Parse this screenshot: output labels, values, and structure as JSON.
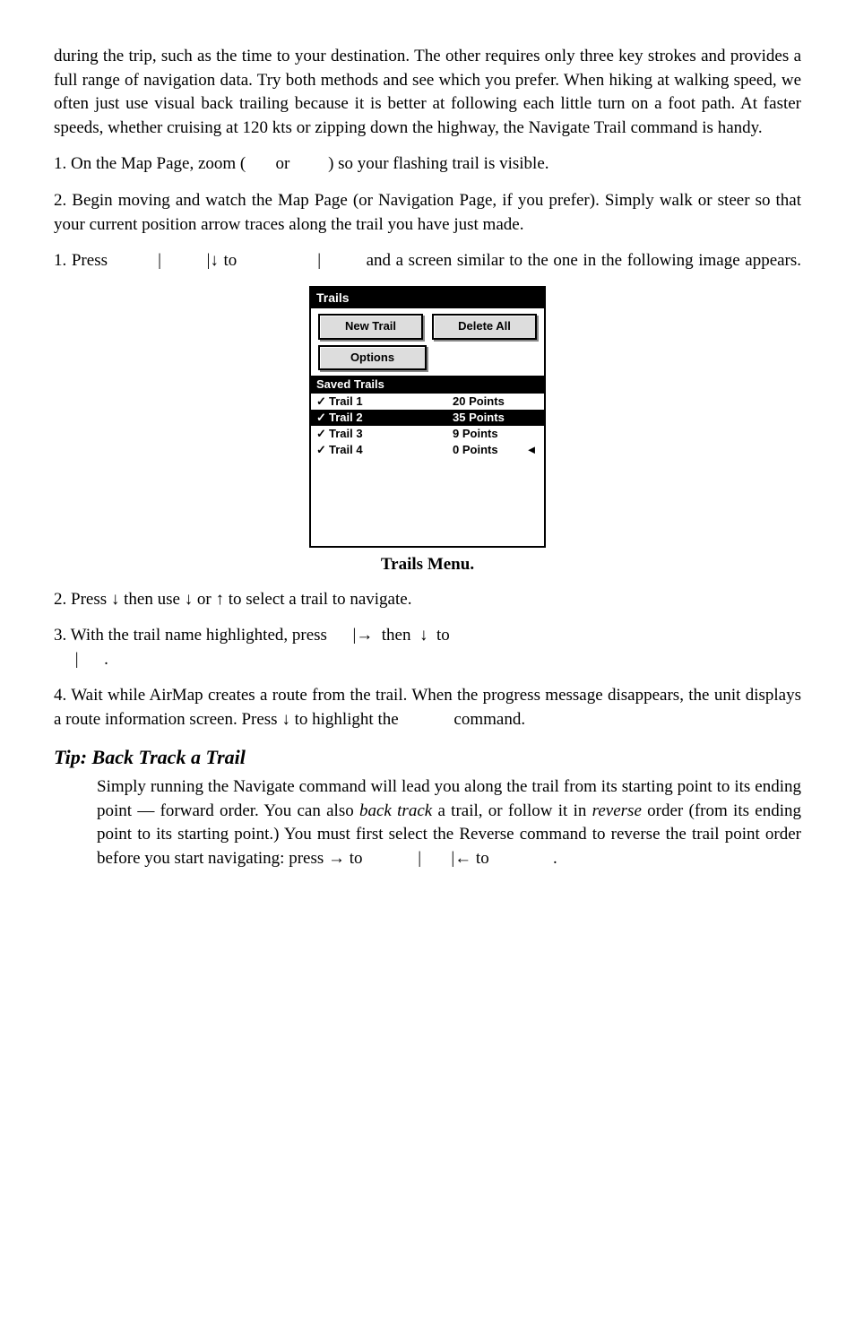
{
  "para_intro": "during the trip, such as the time to your destination. The other requires only three key strokes and provides a full range of navigation data. Try both methods and see which you prefer. When hiking at walking speed, we often just use visual back trailing because it is better at following each little turn on a foot path. At faster speeds, whether cruising at 120 kts or zipping down the highway, the Navigate Trail command is handy.",
  "step1a_pre": "1. On the Map Page, zoom (",
  "step1a_mid": "or",
  "step1a_post": ") so your flashing trail is visible.",
  "step2a": "2. Begin moving and watch the Map Page (or Navigation Page, if you prefer). Simply walk or steer so that your current position arrow traces along the trail you have just made.",
  "step1b_pre": "1. Press",
  "step1b_to": "to",
  "step1b_post": "and a screen similar to the one in the following image appears.",
  "window": {
    "title": "Trails",
    "btn_new": "New Trail",
    "btn_delete": "Delete All",
    "btn_options": "Options",
    "saved_header": "Saved Trails",
    "rows": [
      {
        "name": "Trail 1",
        "pts": "20 Points",
        "inv": false,
        "arrow": ""
      },
      {
        "name": "Trail 2",
        "pts": "35 Points",
        "inv": true,
        "arrow": ""
      },
      {
        "name": "Trail 3",
        "pts": "9 Points",
        "inv": false,
        "arrow": ""
      },
      {
        "name": "Trail 4",
        "pts": "0 Points",
        "inv": false,
        "arrow": "◄"
      }
    ]
  },
  "caption": "Trails Menu.",
  "step2b_pre": "2. Press ",
  "step2b_mid": " then use ",
  "step2b_or": " or ",
  "step2b_post": " to select a trail to navigate.",
  "step3_pre": "3. With the trail name highlighted, press",
  "step3_then": "then",
  "step3_to": "to",
  "step4_pre": "4. Wait while AirMap creates a route from the trail. When the progress message disappears, the unit displays a route information screen. Press ",
  "step4_mid": " to highlight the",
  "step4_post": "command.",
  "tip_heading": "Tip: Back Track a Trail",
  "tip_body_1": "Simply running the Navigate command will lead you along the trail from its starting point to its ending point — forward order. You can also ",
  "tip_body_bt": "back track",
  "tip_body_2": " a trail, or follow it in ",
  "tip_body_rev": "reverse",
  "tip_body_3": " order (from its ending point to its starting point.) You must first select the Reverse command to reverse the trail point order before you start navigating: press ",
  "tip_to1": " to",
  "tip_to2": " to",
  "sep_pipe": "|",
  "sep_dot": ".",
  "arrow_down": "↓",
  "arrow_up": "↑",
  "arrow_right": "→",
  "arrow_left": "←"
}
